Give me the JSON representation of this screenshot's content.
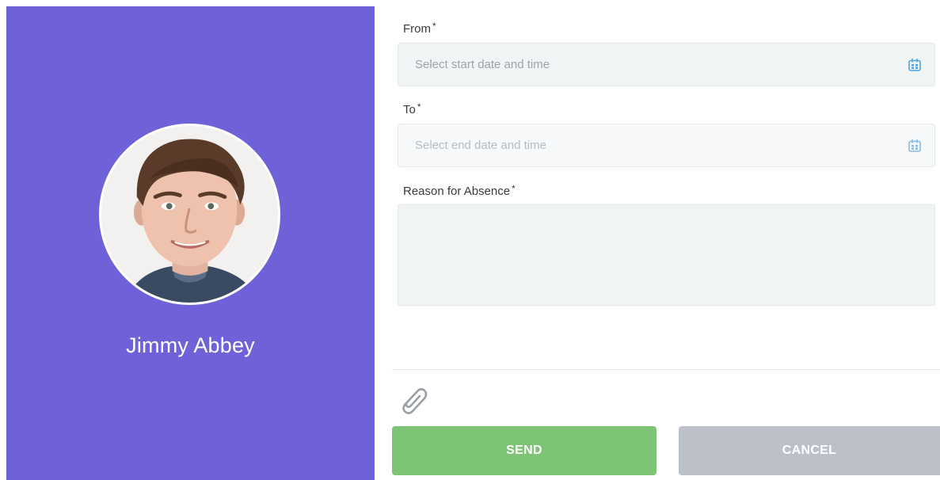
{
  "profile": {
    "name": "Jimmy Abbey",
    "background_color": "#6f62d8"
  },
  "form": {
    "from": {
      "label": "From",
      "required_mark": "*",
      "placeholder": "Select start date and time",
      "icon": "calendar-icon"
    },
    "to": {
      "label": "To",
      "required_mark": "*",
      "placeholder": "Select end date and time",
      "icon": "calendar-icon"
    },
    "reason": {
      "label": "Reason for Absence",
      "required_mark": "*",
      "value": ""
    },
    "attachment_icon": "paperclip-icon"
  },
  "actions": {
    "send_label": "SEND",
    "cancel_label": "CANCEL",
    "send_color": "#7dc476",
    "cancel_color": "#bcc1c9"
  },
  "colors": {
    "accent": "#6f62d8",
    "icon_blue": "#4fa3e0"
  }
}
